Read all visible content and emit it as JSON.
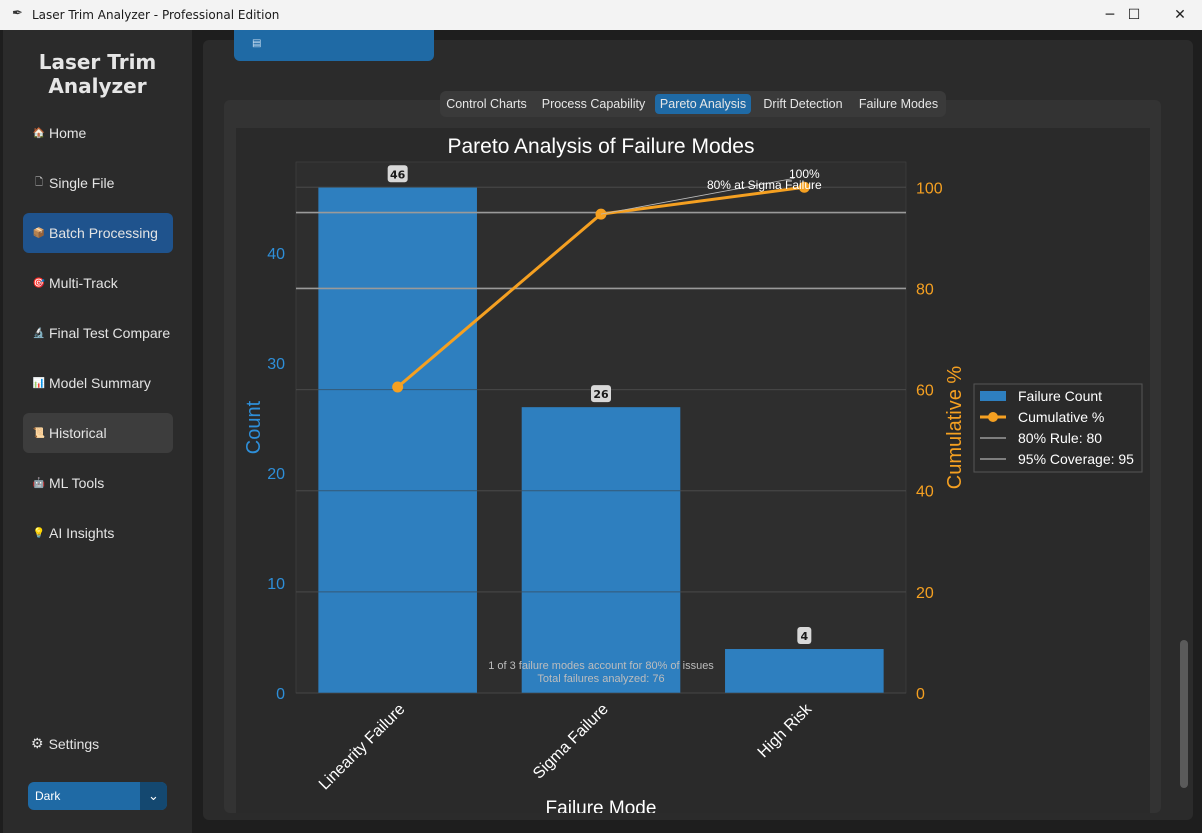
{
  "window": {
    "title": "Laser Trim Analyzer - Professional Edition",
    "icon": "feather-icon",
    "controls": {
      "minimize": "─",
      "maximize": "☐",
      "close": "✕"
    }
  },
  "sidebar": {
    "brand_line1": "Laser Trim",
    "brand_line2": "Analyzer",
    "items": [
      {
        "label": "Home",
        "icon": "house-icon",
        "glyph": "🏠"
      },
      {
        "label": "Single File",
        "icon": "document-icon",
        "glyph": "🗋"
      },
      {
        "label": "Batch Processing",
        "icon": "package-icon",
        "glyph": "📦"
      },
      {
        "label": "Multi-Track",
        "icon": "target-icon",
        "glyph": "🎯"
      },
      {
        "label": "Final Test Compare",
        "icon": "microscope-icon",
        "glyph": "🔬"
      },
      {
        "label": "Model Summary",
        "icon": "chart-icon",
        "glyph": "📊"
      },
      {
        "label": "Historical",
        "icon": "scroll-icon",
        "glyph": "📜"
      },
      {
        "label": "ML Tools",
        "icon": "robot-icon",
        "glyph": "🤖"
      },
      {
        "label": "AI Insights",
        "icon": "lightbulb-icon",
        "glyph": "💡"
      }
    ],
    "active_index": 2,
    "settings_label": "Settings",
    "settings_glyph": "⚙",
    "theme_value": "Dark",
    "theme_arrow": "⌄"
  },
  "top_button_icon": "▤",
  "tabs": [
    {
      "label": "Control Charts"
    },
    {
      "label": "Process Capability"
    },
    {
      "label": "Pareto Analysis"
    },
    {
      "label": "Drift Detection"
    },
    {
      "label": "Failure Modes"
    }
  ],
  "active_tab": 2,
  "colors": {
    "bar": "#2e7fbf",
    "line": "#f5a021",
    "left_axis": "#2e8fd9",
    "right_axis": "#f5a021",
    "accent": "#1f6aa5"
  },
  "chart_data": {
    "type": "bar",
    "title": "Pareto Analysis of Failure Modes",
    "xlabel": "Failure Mode",
    "ylabel": "Count",
    "y2label": "Cumulative %",
    "categories": [
      "Linearity Failure",
      "Sigma Failure",
      "High Risk"
    ],
    "series": [
      {
        "name": "Failure Count",
        "type": "bar",
        "values": [
          46,
          26,
          4
        ]
      },
      {
        "name": "Cumulative %",
        "type": "line",
        "axis": "right",
        "values": [
          60.5,
          94.7,
          100
        ]
      }
    ],
    "bar_labels": [
      "46",
      "26",
      "4"
    ],
    "reference_lines": [
      {
        "name": "80% Rule: 80",
        "value": 80
      },
      {
        "name": "95% Coverage: 95",
        "value": 95
      }
    ],
    "annotations": [
      "100%",
      "80% at Sigma Failure",
      "1 of 3 failure modes account for 80% of issues",
      "Total failures analyzed: 76"
    ],
    "ylim": [
      0,
      48.3
    ],
    "y2lim": [
      0,
      105
    ],
    "yticks": [
      0,
      10,
      20,
      30,
      40
    ],
    "y2ticks": [
      0,
      20,
      40,
      60,
      80,
      100
    ],
    "grid": true,
    "legend_position": "right"
  }
}
